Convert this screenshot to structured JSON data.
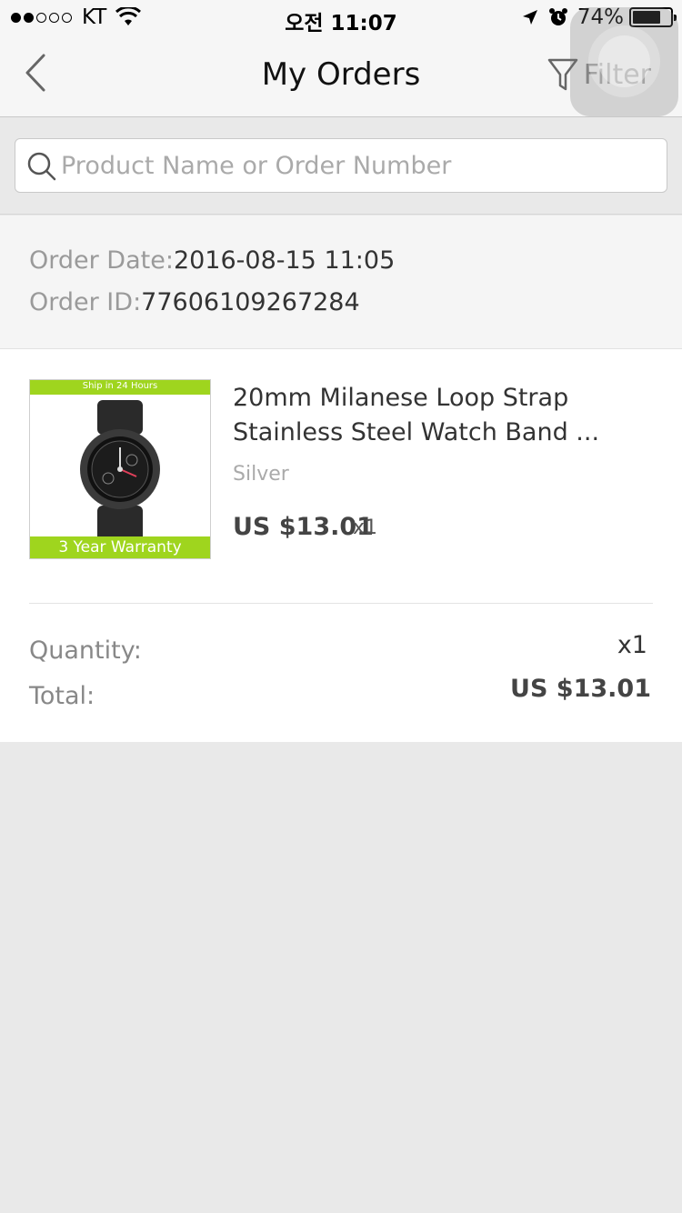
{
  "status_bar": {
    "carrier": "KT",
    "time": "오전 11:07",
    "battery_percent": "74%",
    "battery_level": 0.74,
    "signal_bars": 2
  },
  "nav": {
    "title": "My Orders",
    "filter_label": "Filter"
  },
  "search": {
    "placeholder": "Product Name or Order Number"
  },
  "order": {
    "date_label": "Order Date:",
    "date_value": "2016-08-15 11:05",
    "id_label": "Order ID:",
    "id_value": "77606109267284",
    "product": {
      "title": "20mm Milanese Loop Strap Stainless Steel Watch Band ...",
      "variant": "Silver",
      "price": "US $13.01",
      "qty": "x1",
      "thumb_banner": "Ship in 24 Hours",
      "thumb_caption": "3 Year Warranty"
    },
    "quantity_label": "Quantity:",
    "quantity_value": "x1",
    "total_label": "Total:",
    "total_value": "US $13.01"
  },
  "colors": {
    "accent_green": "#9fd51e",
    "background": "#e9e9e9"
  }
}
